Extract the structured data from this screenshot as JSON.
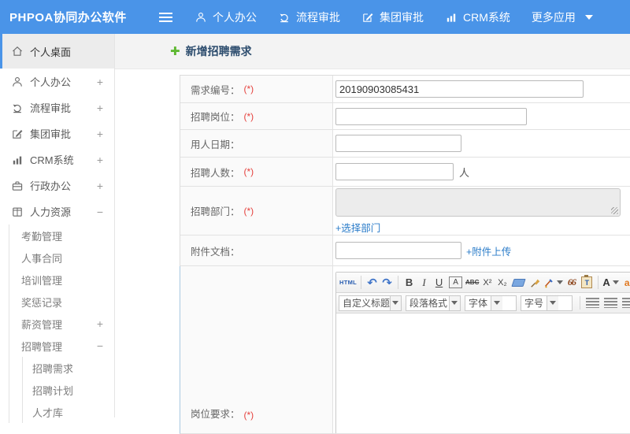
{
  "app": {
    "brand": "PHPOA协同办公软件"
  },
  "header": {
    "nav": [
      {
        "label": "个人办公",
        "icon": "user-icon"
      },
      {
        "label": "流程审批",
        "icon": "process-icon"
      },
      {
        "label": "集团审批",
        "icon": "edit-icon"
      },
      {
        "label": "CRM系统",
        "icon": "chart-icon"
      },
      {
        "label": "更多应用",
        "icon": "caret-down-icon"
      }
    ]
  },
  "sidebar": {
    "items": [
      {
        "label": "个人桌面",
        "icon": "home-icon",
        "active": true
      },
      {
        "label": "个人办公",
        "icon": "user-icon",
        "expand": "+"
      },
      {
        "label": "流程审批",
        "icon": "process-icon",
        "expand": "+"
      },
      {
        "label": "集团审批",
        "icon": "edit-icon",
        "expand": "+"
      },
      {
        "label": "CRM系统",
        "icon": "chart-icon",
        "expand": "+"
      },
      {
        "label": "行政办公",
        "icon": "briefcase-icon",
        "expand": "+"
      },
      {
        "label": "人力资源",
        "icon": "hr-icon",
        "expand": "−"
      },
      {
        "label": "考勤管理"
      },
      {
        "label": "人事合同"
      },
      {
        "label": "培训管理"
      },
      {
        "label": "奖惩记录"
      },
      {
        "label": "薪资管理",
        "expand": "+"
      },
      {
        "label": "招聘管理",
        "expand": "−"
      },
      {
        "label": "招聘需求"
      },
      {
        "label": "招聘计划"
      },
      {
        "label": "人才库"
      }
    ]
  },
  "main": {
    "title": "新增招聘需求",
    "form": {
      "req_no": {
        "label": "需求编号：",
        "required": "(*)",
        "value": "20190903085431"
      },
      "job": {
        "label": "招聘岗位：",
        "required": "(*)",
        "value": ""
      },
      "date": {
        "label": "用人日期：",
        "value": ""
      },
      "count": {
        "label": "招聘人数：",
        "required": "(*)",
        "value": "",
        "suffix": "人"
      },
      "dept": {
        "label": "招聘部门：",
        "required": "(*)",
        "link": "+选择部门"
      },
      "attach": {
        "label": "附件文档：",
        "value": "",
        "link": "+附件上传"
      },
      "requirement": {
        "label": "岗位要求：",
        "required": "(*)"
      }
    },
    "editor": {
      "html_btn": "HTML",
      "bold": "B",
      "italic": "I",
      "underline": "U",
      "boxed_a": "A",
      "strike": "ABC",
      "sup": "X²",
      "sub": "X₂",
      "quote": "66",
      "clip_t": "T",
      "font_color": "A",
      "auto_a": "a",
      "dropdowns": [
        {
          "label": "自定义标题"
        },
        {
          "label": "段落格式"
        },
        {
          "label": "字体"
        },
        {
          "label": "字号"
        }
      ]
    }
  },
  "colors": {
    "header_blue": "#4a94e8",
    "link_blue": "#2b7cc9",
    "required_red": "#e5413d",
    "plus_green": "#5fb832"
  }
}
